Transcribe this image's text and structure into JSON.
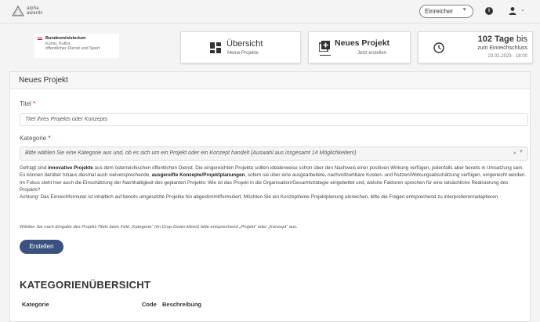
{
  "brand": {
    "line1": "alpha",
    "line2": "awards"
  },
  "topbar": {
    "role_select": "Einreicher",
    "info_icon": "info-icon",
    "user_icon": "user-icon"
  },
  "ministry": {
    "name": "Bundesministerium",
    "line2": "Kunst, Kultur,",
    "line3": "öffentlicher Dienst und Sport"
  },
  "nav": [
    {
      "title": "Übersicht",
      "subtitle": "Meine Projekte",
      "icon": "dashboard-icon"
    },
    {
      "title": "Neues Projekt",
      "subtitle": "Jetzt erstellen",
      "icon": "add-project-icon"
    }
  ],
  "deadline": {
    "days": "102 Tage",
    "until": "bis",
    "label": "zum Einreichschluss",
    "date": "23.01.2023 - 18:00",
    "icon": "clock-icon"
  },
  "form": {
    "panel_title": "Neues Projekt",
    "title_label": "Titel",
    "title_placeholder": "Titel Ihres Projekts oder Konzepts",
    "category_label": "Kategorie",
    "category_placeholder": "Bitte wählen Sie eine Kategorie aus und, ob es sich um ein Projekt oder ein Konzept handelt (Auswahl aus insgesamt 14 Möglichkeiten!)",
    "required_mark": "*",
    "desc_p1_a": "Gefragt sind ",
    "desc_p1_b": "innovative Projekte",
    "desc_p1_c": " aus dem österreichischen öffentlichen Dienst. Die eingereichten Projekte sollten idealerweise schon über den Nachweis einer positiven Wirkung verfügen, jedenfalls aber bereits in Umsetzung sein. Es können darüber hinaus diesmal auch vielversprechende, ",
    "desc_p1_d": "ausgereifte Konzepte/Projektplanungen",
    "desc_p1_e": ", sofern sie über eine ausgearbeitete, nachvollziehbare Kosten- und Nutzen/Wirkungsabschätzung verfügen, eingereicht werden. Im Fokus steht hier auch die Einschätzung der Nachhaltigkeit des geplanten Projekts: Wie ist das Projekt in die Organisation/Gesamtstrategie eingebettet und, welche Faktoren sprechen für eine tatsächliche Realisierung des Projekts?",
    "desc_p2": "Achtung: Das Einreichformular ist inhaltlich auf bereits umgesetzte Projekte hin abgestimmt/formuliert. Möchten Sie ein Konzept/eine Projektplanung einreichen, bitte die Fragen entsprechend zu interpretieren/adaptieren.",
    "hint": "Wählen Sie nach Eingabe des Projekt-Titels beim Feld „Kategorie“ (im Drop-Down-Menü) bitte entsprechend „Projekt“ oder „Konzept“ aus.",
    "submit_label": "Erstellen"
  },
  "category_overview": {
    "heading": "KATEGORIENÜBERSICHT",
    "columns": [
      "Kategorie",
      "Code",
      "Beschreibung"
    ]
  },
  "colors": {
    "primary_button": "#3a527f",
    "required": "#dd0000",
    "flag_red": "#e4002b"
  }
}
